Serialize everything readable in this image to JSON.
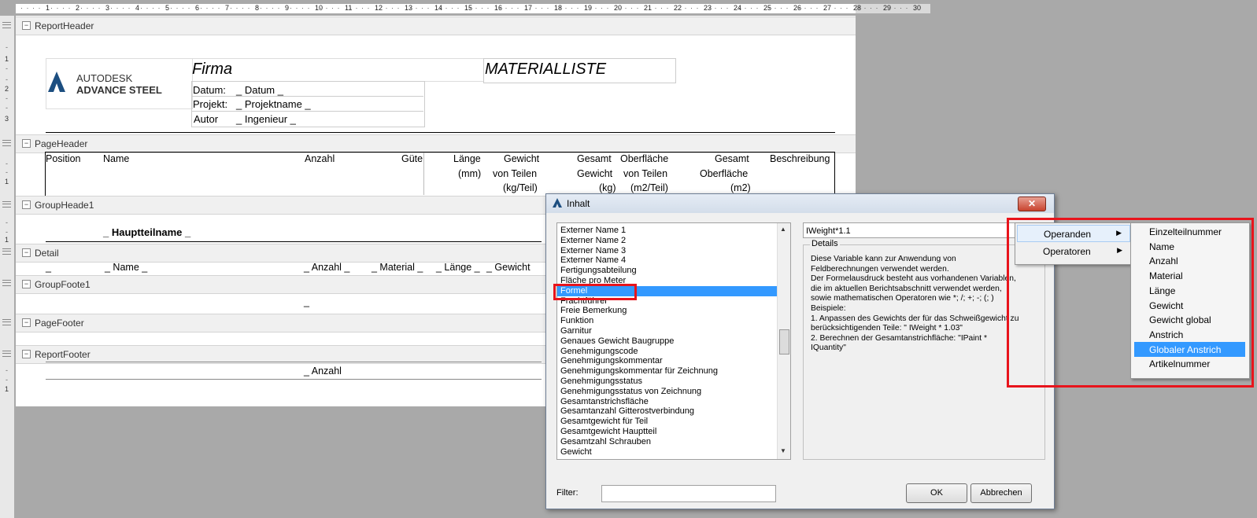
{
  "ruler": {
    "numbers": [
      "1",
      "2",
      "3",
      "4",
      "5",
      "6",
      "7",
      "8",
      "9",
      "10",
      "11",
      "12",
      "13",
      "14",
      "15",
      "16",
      "17",
      "18",
      "19",
      "20",
      "21",
      "22",
      "23",
      "24",
      "25",
      "26",
      "27",
      "28",
      "29",
      "30"
    ],
    "vertical": [
      "1",
      "2",
      "3",
      "1",
      "1",
      "1"
    ]
  },
  "bands": {
    "report_header": "ReportHeader",
    "page_header": "PageHeader",
    "group_header": "GroupHeade1",
    "detail": "Detail",
    "group_footer": "GroupFoote1",
    "page_footer": "PageFooter",
    "report_footer": "ReportFooter"
  },
  "header": {
    "logo_line1": "AUTODESK",
    "logo_line2": "ADVANCE STEEL",
    "firma": "Firma",
    "title": "MATERIALLISTE",
    "datum_label": "Datum:",
    "datum_value": "_ Datum _",
    "projekt_label": "Projekt:",
    "projekt_value": "_ Projektname _",
    "autor_label": "Autor",
    "autor_value": "_ Ingenieur _"
  },
  "columns": {
    "position": "Position",
    "name": "Name",
    "anzahl": "Anzahl",
    "guete": "Güte",
    "laenge_1": "Länge",
    "laenge_2": "(mm)",
    "gewicht_1": "Gewicht",
    "gewicht_2": "von Teilen",
    "gewicht_3": "(kg/Teil)",
    "gesamt_gewicht_1": "Gesamt",
    "gesamt_gewicht_2": "Gewicht",
    "gesamt_gewicht_3": "(kg)",
    "oberflaeche_1": "Oberfläche",
    "oberflaeche_2": "von Teilen",
    "oberflaeche_3": "(m2/Teil)",
    "gesamt_ober_1": "Gesamt",
    "gesamt_ober_2": "Oberfläche",
    "gesamt_ober_3": "(m2)",
    "beschreibung": "Beschreibung"
  },
  "group_header": {
    "field": "_ Hauptteilname _"
  },
  "detail": {
    "f0": "_",
    "name": "_ Name _",
    "anzahl": "_ Anzahl _",
    "material": "_ Material _",
    "laenge": "_ Länge _",
    "gewicht": "_ Gewicht"
  },
  "group_footer": {
    "field": "_"
  },
  "report_footer": {
    "anzahl": "_ Anzahl"
  },
  "dialog": {
    "title": "Inhalt",
    "close": "✕",
    "list_items": [
      "Externer Name 1",
      "Externer Name 2",
      "Externer Name 3",
      "Externer Name 4",
      "Fertigungsabteilung",
      "Fläche pro Meter",
      "Formel",
      "Frachtführer",
      "Freie Bemerkung",
      "Funktion",
      "Garnitur",
      "Genaues Gewicht Baugruppe",
      "Genehmigungscode",
      "Genehmigungskommentar",
      "Genehmigungskommentar für Zeichnung",
      "Genehmigungsstatus",
      "Genehmigungsstatus von Zeichnung",
      "Gesamtanstrichsfläche",
      "Gesamtanzahl Gitterostverbindung",
      "Gesamtgewicht für Teil",
      "Gesamtgewicht Hauptteil",
      "Gesamtzahl Schrauben",
      "Gewicht"
    ],
    "selected_index": 6,
    "formula": "IWeight*1.1",
    "details_legend": "Details",
    "details_text": "Diese Variable kann zur Anwendung von\nFeldberechnungen verwendet werden.\nDer Formelausdruck besteht aus vorhandenen Variablen,\ndie im aktuellen Berichtsabschnitt verwendet werden,\nsowie mathematischen Operatoren wie *; /; +; -; (; )\nBeispiele:\n  1. Anpassen des Gewichts der für das Schweißgewicht zu\nberücksichtigenden Teile: \" IWeight * 1.03\"\n  2. Berechnen der Gesamtanstrichfläche: \"IPaint *\nIQuantity\"",
    "filter_label": "Filter:",
    "filter_value": "",
    "ok": "OK",
    "cancel": "Abbrechen"
  },
  "menu": {
    "operanden": "Operanden",
    "operatoren": "Operatoren",
    "submenu": [
      "Einzelteilnummer",
      "Name",
      "Anzahl",
      "Material",
      "Länge",
      "Gewicht",
      "Gewicht global",
      "Anstrich",
      "Globaler Anstrich",
      "Artikelnummer"
    ],
    "active_index": 8
  },
  "colors": {
    "highlight": "#e8141c",
    "selection": "#3399ff"
  }
}
